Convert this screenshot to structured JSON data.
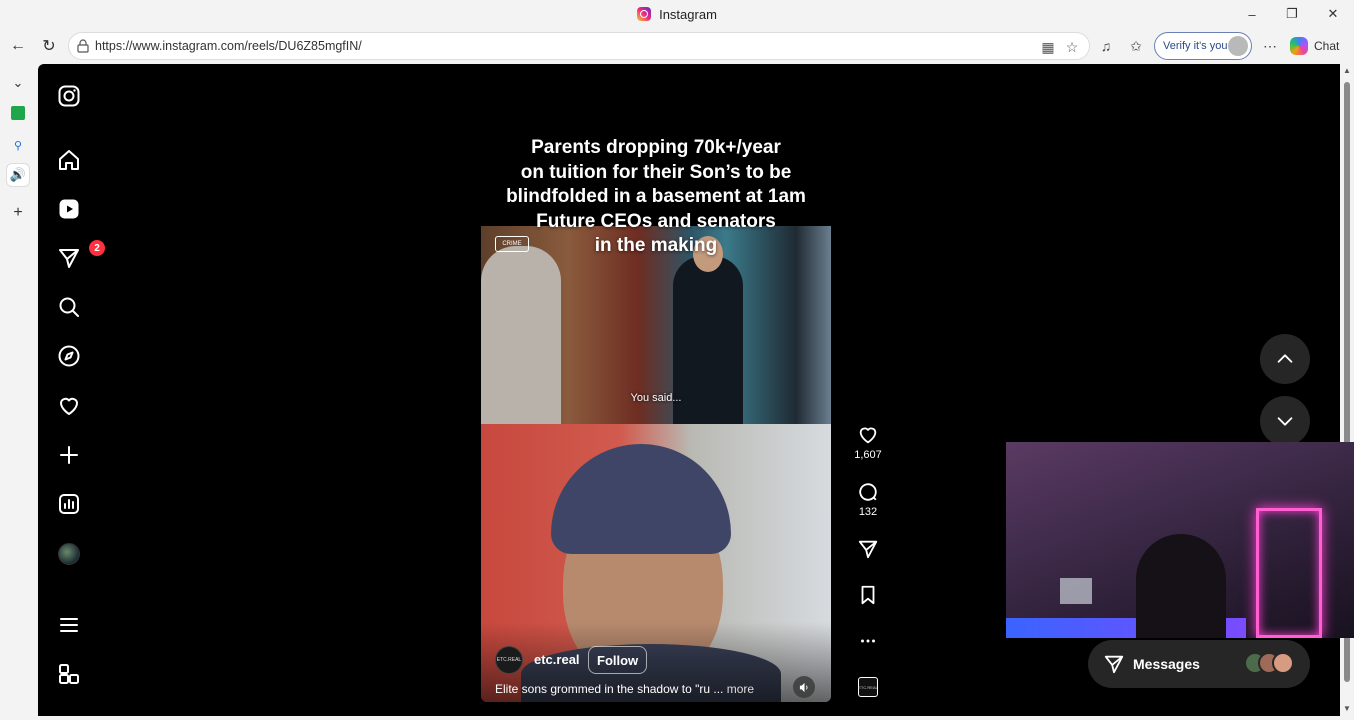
{
  "window": {
    "title": "Instagram"
  },
  "browser": {
    "url": "https://www.instagram.com/reels/DU6Z85mgfIN/",
    "verify_label": "Verify it's you",
    "chat_label": "Chat"
  },
  "reel": {
    "caption_lines": [
      "Parents dropping 70k+/year",
      "on tuition for their Son’s to be",
      "blindfolded in a basement at 1am",
      "Future CEOs and senators",
      "in the making"
    ],
    "clip_tag": "CRIME",
    "subtitle": "You said...",
    "author": "etc.real",
    "author_avatar_text": "ETC.REAL",
    "follow_label": "Follow",
    "description": "Elite sons grommed in the shadow to \"ru ...",
    "more_label": "more",
    "likes": "1,607",
    "comments": "132"
  },
  "nav": {
    "notification_count": "2"
  },
  "messages": {
    "label": "Messages"
  },
  "colors": {
    "ig_background": "#000000",
    "badge": "#ff3040",
    "button_bg": "#262626"
  }
}
